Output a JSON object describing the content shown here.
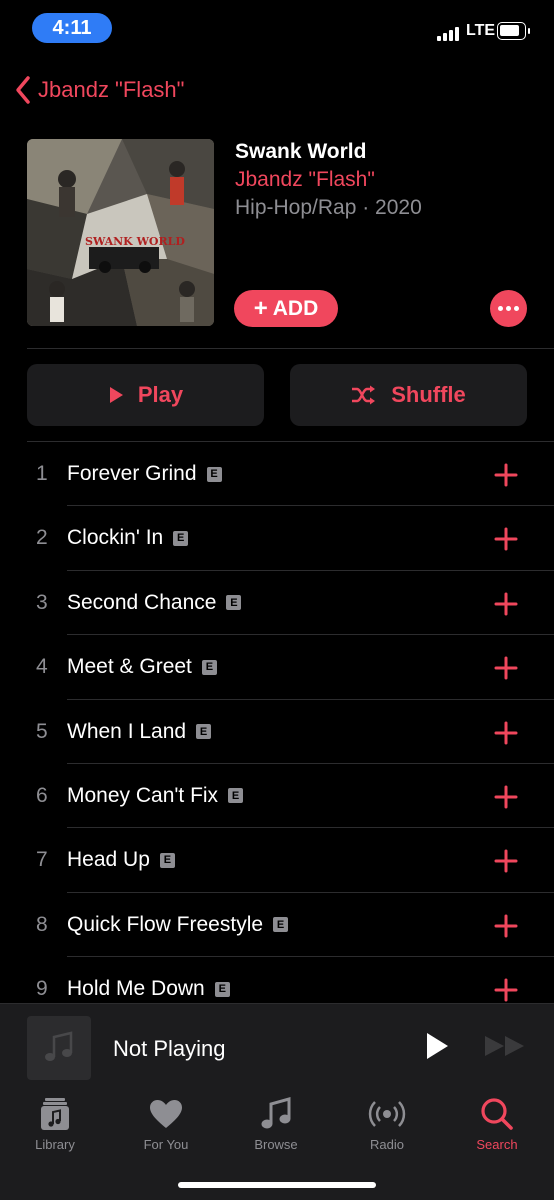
{
  "status_bar": {
    "time": "4:11",
    "network": "LTE"
  },
  "nav": {
    "back_label": "Jbandz \"Flash\""
  },
  "album": {
    "title": "Swank World",
    "artist": "Jbandz \"Flash\"",
    "meta": "Hip-Hop/Rap · 2020",
    "artwork_text": "SWANK WORLD"
  },
  "actions": {
    "add_label": "ADD",
    "play_label": "Play",
    "shuffle_label": "Shuffle"
  },
  "tracks": [
    {
      "number": "1",
      "title": "Forever Grind",
      "explicit": "E"
    },
    {
      "number": "2",
      "title": "Clockin' In",
      "explicit": "E"
    },
    {
      "number": "3",
      "title": "Second Chance",
      "explicit": "E"
    },
    {
      "number": "4",
      "title": "Meet & Greet",
      "explicit": "E"
    },
    {
      "number": "5",
      "title": "When I Land",
      "explicit": "E"
    },
    {
      "number": "6",
      "title": "Money Can't Fix",
      "explicit": "E"
    },
    {
      "number": "7",
      "title": "Head Up",
      "explicit": "E"
    },
    {
      "number": "8",
      "title": "Quick Flow Freestyle",
      "explicit": "E"
    },
    {
      "number": "9",
      "title": "Hold Me Down",
      "explicit": "E"
    }
  ],
  "mini_player": {
    "status": "Not Playing"
  },
  "tabs": [
    {
      "label": "Library",
      "icon": "library-icon",
      "active": false
    },
    {
      "label": "For You",
      "icon": "heart-icon",
      "active": false
    },
    {
      "label": "Browse",
      "icon": "music-note-icon",
      "active": false
    },
    {
      "label": "Radio",
      "icon": "radio-icon",
      "active": false
    },
    {
      "label": "Search",
      "icon": "search-icon",
      "active": true
    }
  ],
  "colors": {
    "accent": "#f0475d",
    "background": "#000000",
    "secondary_text": "#8e8e93",
    "surface": "#1c1c1e"
  }
}
